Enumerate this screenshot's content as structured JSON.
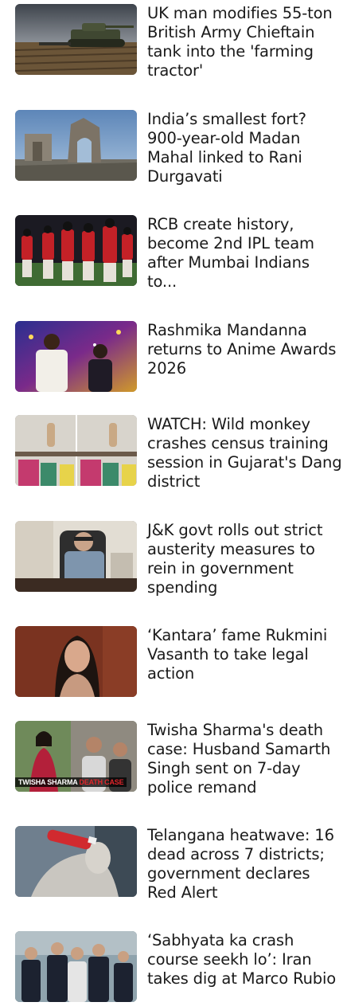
{
  "feed": {
    "stories": [
      {
        "headline": "UK man modifies 55-ton British Army Chieftain tank into the 'farming tractor'",
        "thumbnail_icon": "tank-farm-photo"
      },
      {
        "headline": "India’s smallest fort? 900-year-old Madan Mahal linked to Rani Durgavati",
        "thumbnail_icon": "ruined-fort-photo"
      },
      {
        "headline": "RCB create history, become 2nd IPL team after Mumbai Indians to...",
        "thumbnail_icon": "cricket-team-photo"
      },
      {
        "headline": "Rashmika Mandanna returns to Anime Awards 2026",
        "thumbnail_icon": "awards-stage-photo"
      },
      {
        "headline": "WATCH: Wild monkey crashes census training session in Gujarat's Dang district",
        "thumbnail_icon": "monkey-classroom-photo"
      },
      {
        "headline": "J&K govt rolls out strict austerity measures to rein in government spending",
        "thumbnail_icon": "official-desk-photo"
      },
      {
        "headline": "‘Kantara’ fame Rukmini Vasanth to take legal action",
        "thumbnail_icon": "actress-portrait-photo"
      },
      {
        "headline": "Twisha Sharma's death case: Husband Samarth Singh sent on 7-day police remand",
        "thumbnail_icon": "couple-photo",
        "thumbnail_caption": {
          "primary": "TWISHA SHARMA",
          "accent": "DEATH CASE"
        }
      },
      {
        "headline": "Telangana heatwave: 16 dead across 7 districts; government declares Red Alert",
        "thumbnail_icon": "drinking-water-photo"
      },
      {
        "headline": "‘Sabhyata ka crash course seekh lo’: Iran takes dig at Marco Rubio",
        "thumbnail_icon": "officials-walking-photo"
      }
    ]
  }
}
